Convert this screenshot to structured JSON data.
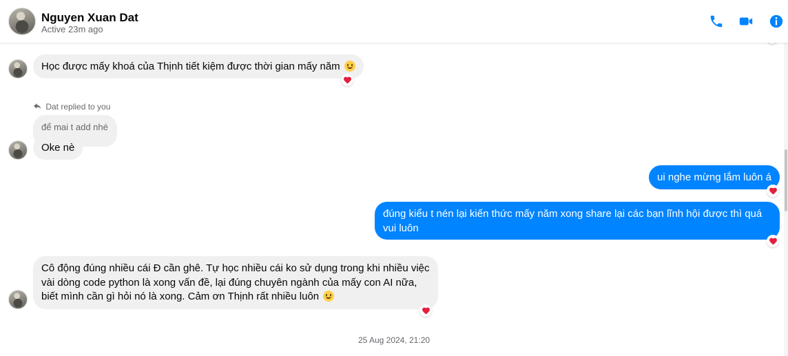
{
  "header": {
    "name": "Nguyen Xuan Dat",
    "status": "Active 23m ago",
    "icons": [
      "phone-icon",
      "video-call-icon",
      "info-icon"
    ],
    "accent": "#0084ff"
  },
  "messages": [
    {
      "side": "in",
      "text": "Học được mấy khoá của Thịnh tiết kiệm được thời gian mấy năm",
      "emoji": "smiley",
      "reaction": "heart"
    },
    {
      "replied_label": "Dat replied to you",
      "quoted_text": "để mai t add nhé"
    },
    {
      "side": "in",
      "text": "Oke nè"
    },
    {
      "side": "out",
      "text": "ui nghe mừng lắm luôn á",
      "reaction": "heart"
    },
    {
      "side": "out",
      "lines": [
        "đúng kiểu t nén lại kiến thức mấy năm xong share lại các bạn lĩnh hội được thì quá",
        "vui luôn"
      ],
      "reaction": "heart"
    },
    {
      "side": "in",
      "lines": [
        "Cô động đúng nhiều cái Đ cần ghê. Tự học nhiều cái ko sử dụng trong khi nhiều việc",
        "vài dòng code python là xong vấn đề, lại đúng chuyên ngành của mấy con AI nữa,",
        "biết mình cần gì hỏi nó là xong. Cảm ơn Thịnh rất nhiều luôn"
      ],
      "emoji": "smiley",
      "reaction": "heart"
    }
  ],
  "timestamp": "25 Aug 2024, 21:20",
  "colors": {
    "incoming_bg": "#f0f0f0",
    "outgoing_bg": "#0084ff",
    "heart": "#e41e3f"
  }
}
